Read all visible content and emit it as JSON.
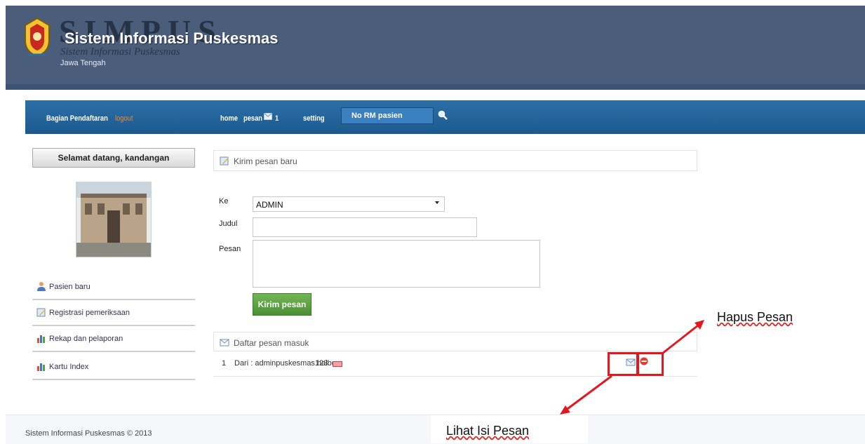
{
  "header": {
    "logo_text": "SIMPUS",
    "logo_subtitle": "Sistem Informasi Puskesmas",
    "title": "Sistem Informasi Puskesmas",
    "region": "Jawa Tengah"
  },
  "navbar": {
    "role": "Bagian Pendaftaran",
    "logout": "logout",
    "home": "home",
    "pesan": "pesan",
    "message_count": "1",
    "setting": "setting",
    "search_placeholder": "No RM pasien"
  },
  "sidebar": {
    "welcome": "Selamat datang, kandangan",
    "items": [
      {
        "label": "Pasien baru",
        "icon": "user-icon"
      },
      {
        "label": "Registrasi pemeriksaan",
        "icon": "edit-icon"
      },
      {
        "label": "Rekap dan pelaporan",
        "icon": "bar-chart-icon"
      },
      {
        "label": "Kartu Index",
        "icon": "bar-chart-icon"
      }
    ]
  },
  "compose": {
    "title": "Kirim pesan baru",
    "to_label": "Ke",
    "to_value": "ADMIN",
    "subject_label": "Judul",
    "subject_value": "",
    "body_label": "Pesan",
    "body_value": "",
    "submit_label": "Kirim pesan"
  },
  "inbox": {
    "title": "Daftar pesan masuk",
    "rows": [
      {
        "no": "1",
        "from": "Dari : adminpuskesmas123",
        "subject": "halbo"
      }
    ]
  },
  "annotations": {
    "delete_label": "Hapus Pesan",
    "view_label": "Lihat Isi Pesan",
    "color": "#e3181e"
  },
  "footer": {
    "text": "Sistem Informasi Puskesmas © 2013"
  },
  "colors": {
    "header_bg": "#4a5d7a",
    "navbar_bg": "#1d5a8e",
    "logout_accent": "#e98a2c",
    "button_green": "#4b8f33"
  }
}
